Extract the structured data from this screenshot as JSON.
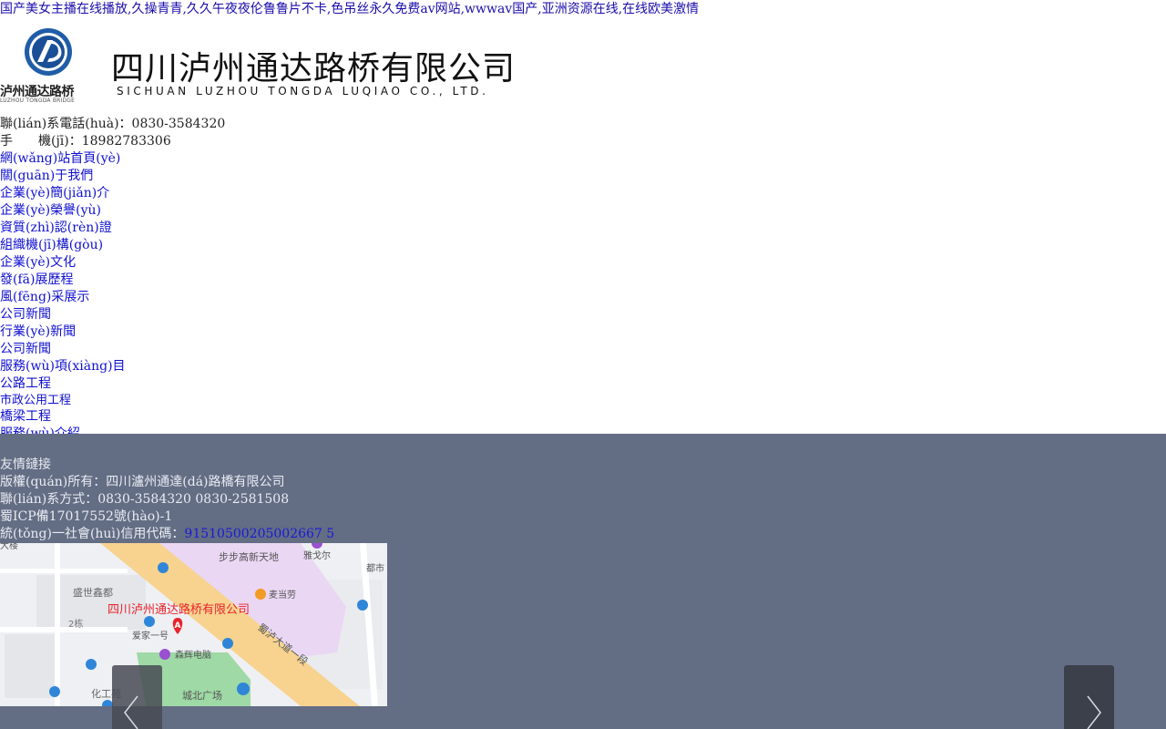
{
  "top_text": "国产美女主播在线播放,久操青青,久久午夜夜伦鲁鲁片不卡,色吊丝永久免费av网站,wwwav国产,亚洲资源在线,在线欧美激情",
  "logo": {
    "cn": "四川泸州通达路桥有限公司",
    "en": "SICHUAN LUZHOU TONGDA LUQIAO CO., LTD.",
    "sub_cn": "泸州通达路桥",
    "sub_en": "LUZHOU TONGDA BRIDGE"
  },
  "contact": {
    "phone": "聯(lián)系電話(huà)：0830-3584320",
    "mobile": "手　　機(jī)：18982783306"
  },
  "nav": [
    {
      "label": "網(wǎng)站首頁(yè)"
    },
    {
      "label": "關(guān)于我們"
    },
    {
      "label": "企業(yè)簡(jiǎn)介"
    },
    {
      "label": "企業(yè)榮譽(yù)"
    },
    {
      "label": "資質(zhì)認(rèn)證"
    },
    {
      "label": "組織機(jī)構(gòu)"
    },
    {
      "label": "企業(yè)文化"
    },
    {
      "label": "發(fā)展歷程"
    },
    {
      "label": "風(fēng)采展示"
    },
    {
      "label": "公司新聞"
    },
    {
      "label": "行業(yè)新聞"
    },
    {
      "label": "公司新聞"
    },
    {
      "label": "服務(wù)項(xiàng)目"
    },
    {
      "label": "公路工程"
    },
    {
      "label": "市政公用工程"
    },
    {
      "label": "橋梁工程"
    },
    {
      "label": "服務(wù)介紹"
    }
  ],
  "footer": {
    "links_title": "友情鏈接",
    "copyright": "版權(quán)所有：四川瀘州通達(dá)路橋有限公司",
    "contact": "聯(lián)系方式：0830-3584320 0830-2581508",
    "icp": "蜀ICP備17017552號(hào)-1",
    "credit_label": "統(tǒng)一社會(huì)信用代碼：",
    "credit_code": "91510500205002667 5"
  },
  "map": {
    "company_label": "四川泸州通达路桥有限公司",
    "marker": "A",
    "places": [
      "步步高新天地",
      "雅戈尔",
      "都市",
      "麦当劳",
      "盛世鑫都",
      "2栋",
      "爱家一号",
      "森辉电脑",
      "蜀泸大道一段",
      "化工苑",
      "城北广场",
      "大楼"
    ]
  },
  "colors": {
    "link": "#1010d0",
    "footer_bg": "#636d84",
    "footer_text": "#e9ecf2",
    "map_road": "#f7d38f",
    "map_area_pink": "#ead7f3",
    "map_green": "#9ed9a6",
    "map_marker": "#e8232b"
  },
  "icons": {
    "left_arrow": "chevron-left-icon",
    "right_arrow": "chevron-right-icon"
  }
}
